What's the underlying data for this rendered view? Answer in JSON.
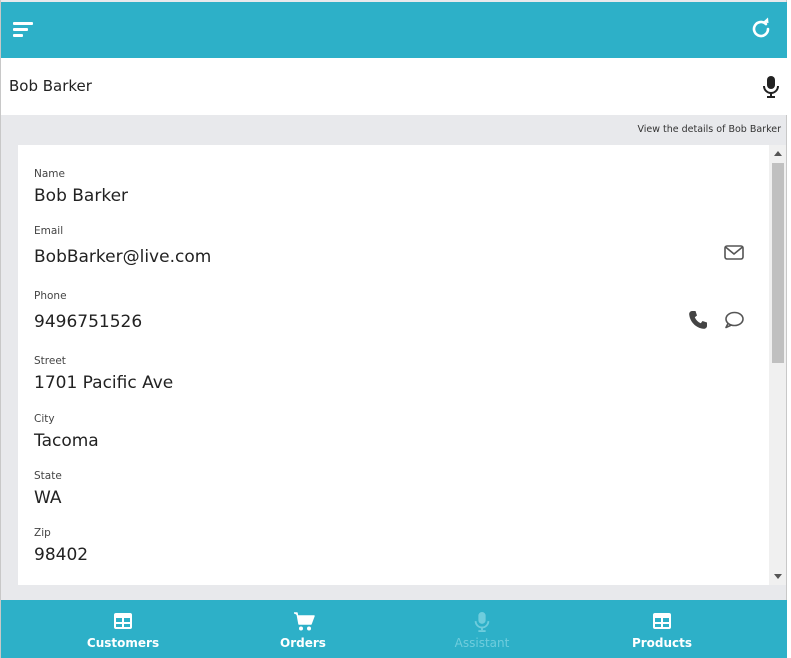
{
  "header": {
    "menu_icon": "hamburger-menu-icon",
    "refresh_icon": "refresh-icon",
    "color": "#2db0c8"
  },
  "titlebar": {
    "title": "Bob Barker",
    "mic_icon": "microphone-icon"
  },
  "hint": "View the details of Bob Barker",
  "details": {
    "name": {
      "label": "Name",
      "value": "Bob Barker"
    },
    "email": {
      "label": "Email",
      "value": "BobBarker@live.com"
    },
    "phone": {
      "label": "Phone",
      "value": "9496751526"
    },
    "street": {
      "label": "Street",
      "value": "1701 Pacific Ave"
    },
    "city": {
      "label": "City",
      "value": "Tacoma"
    },
    "state": {
      "label": "State",
      "value": "WA"
    },
    "zip": {
      "label": "Zip",
      "value": "98402"
    }
  },
  "nav": {
    "customers": {
      "label": "Customers",
      "icon": "table-icon"
    },
    "orders": {
      "label": "Orders",
      "icon": "cart-icon"
    },
    "assistant": {
      "label": "Assistant",
      "icon": "microphone-icon"
    },
    "products": {
      "label": "Products",
      "icon": "table-icon"
    }
  }
}
